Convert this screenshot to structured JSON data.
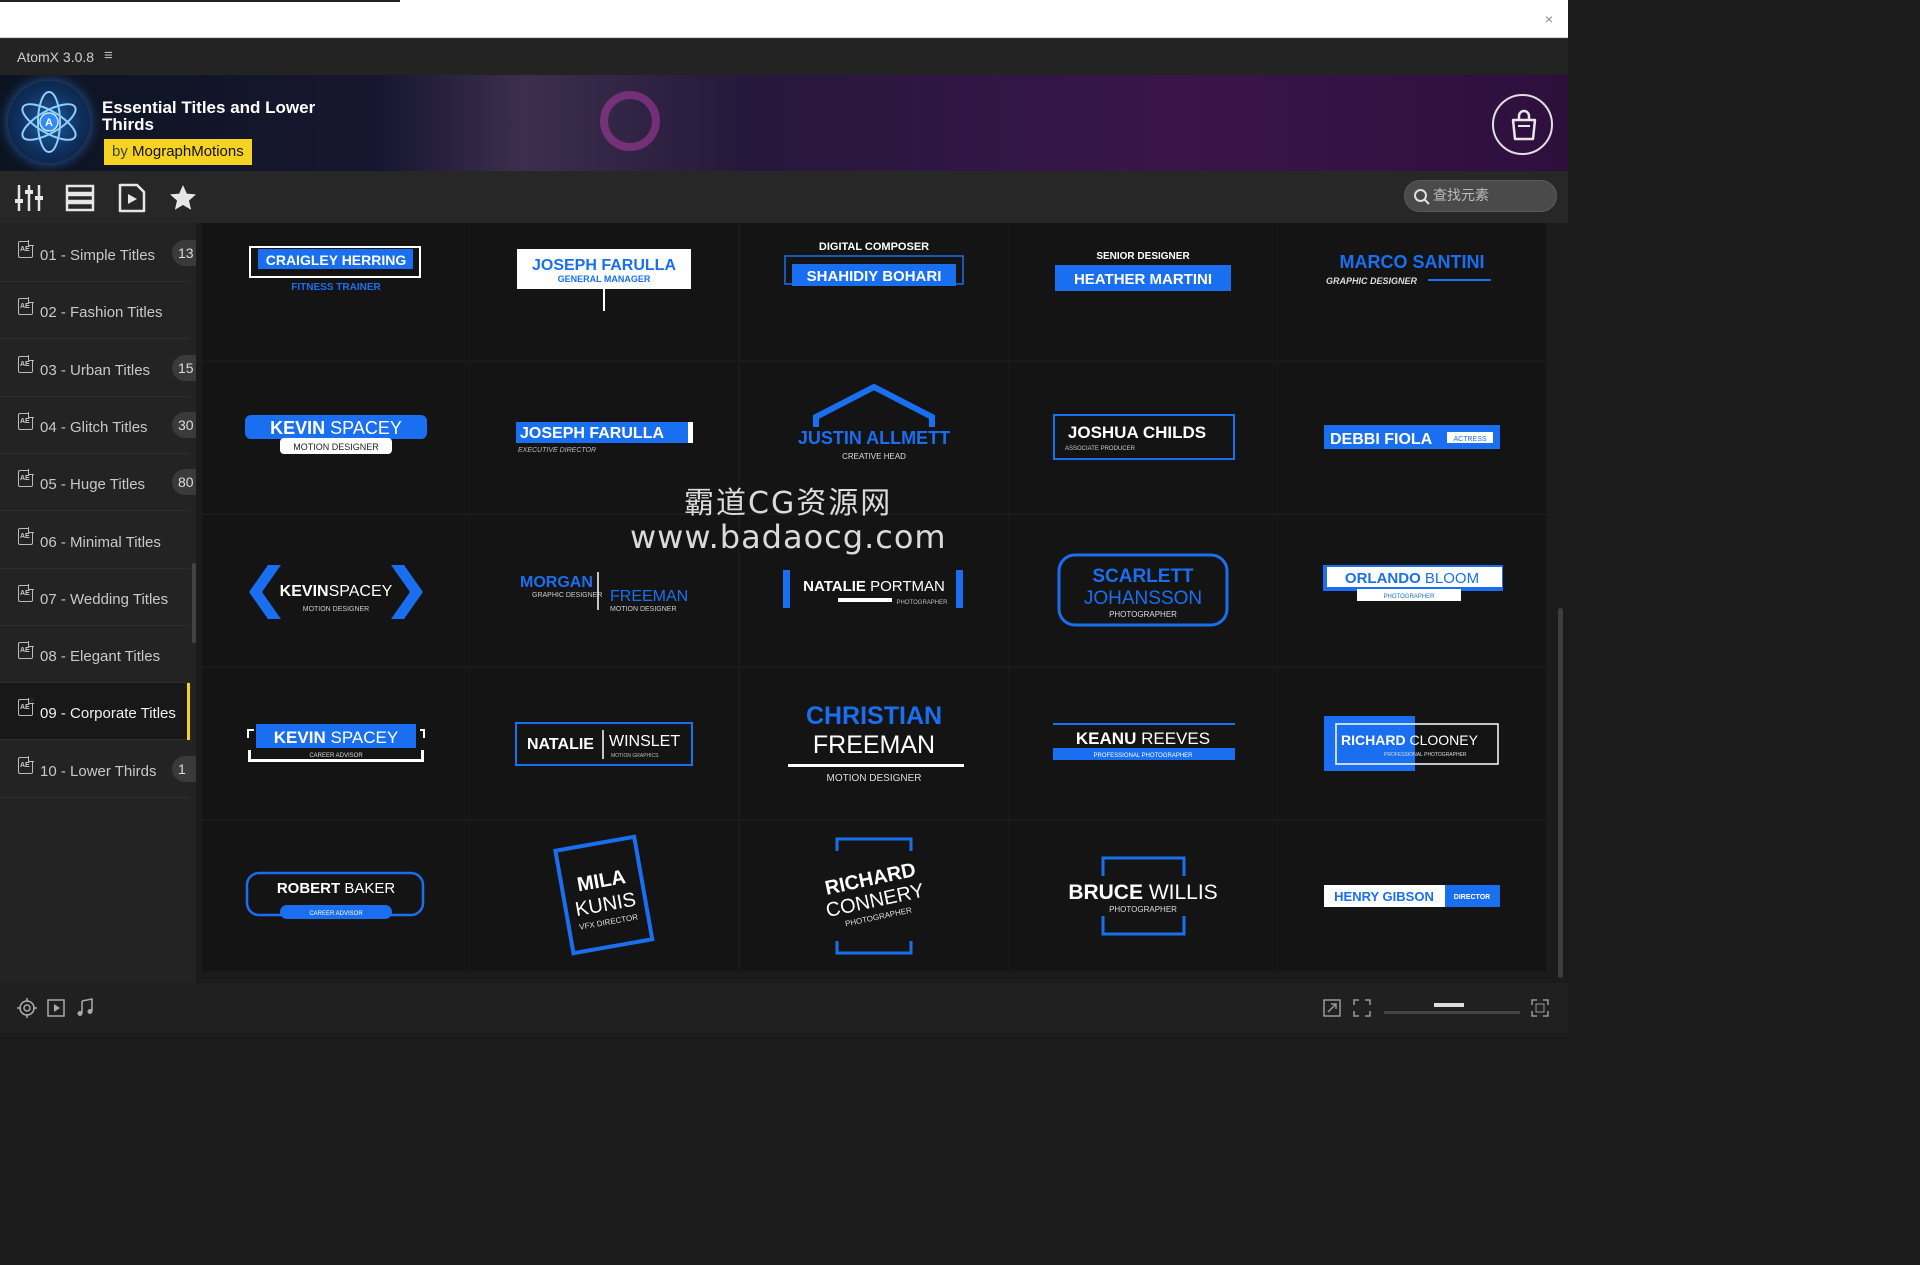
{
  "window": {
    "app_title": "AtomX 3.0.8",
    "menu_icon": "hamburger-menu-icon"
  },
  "banner": {
    "product_title": "Essential Titles and Lower Thirds",
    "author_prefix": "by",
    "author": "MographMotions",
    "cart_icon": "shopping-bag-icon"
  },
  "toolbar": {
    "icons": [
      "sliders-icon",
      "list-view-icon",
      "preview-icon",
      "star-icon"
    ],
    "search": {
      "placeholder": "查找元素",
      "value": ""
    }
  },
  "sidebar": {
    "items": [
      {
        "label": "01 - Simple Titles",
        "count": "13",
        "active": false
      },
      {
        "label": "02 - Fashion Titles",
        "count": "",
        "active": false
      },
      {
        "label": "03 - Urban Titles",
        "count": "15",
        "active": false
      },
      {
        "label": "04 - Glitch Titles",
        "count": "30",
        "active": false
      },
      {
        "label": "05 - Huge Titles",
        "count": "80",
        "active": false
      },
      {
        "label": "06 - Minimal Titles",
        "count": "",
        "active": false
      },
      {
        "label": "07 - Wedding Titles",
        "count": "",
        "active": false
      },
      {
        "label": "08 - Elegant Titles",
        "count": "",
        "active": false
      },
      {
        "label": "09 - Corporate Titles",
        "count": "",
        "active": true
      },
      {
        "label": "10 - Lower Thirds",
        "count": "1",
        "active": false
      }
    ]
  },
  "accent_color": "#1a6ff0",
  "tiles": [
    {
      "style": "t1",
      "name": "CRAIGLEY HERRING",
      "role": "FITNESS TRAINER"
    },
    {
      "style": "t2",
      "name": "JOSEPH FARULLA",
      "role": "GENERAL MANAGER"
    },
    {
      "style": "t3",
      "name": "SHAHIDIY BOHARI",
      "role": "DIGITAL COMPOSER"
    },
    {
      "style": "t4",
      "name": "HEATHER MARTINI",
      "role": "SENIOR DESIGNER"
    },
    {
      "style": "t5",
      "name": "MARCO SANTINI",
      "role": "GRAPHIC DESIGNER"
    },
    {
      "style": "t6",
      "first": "KEVIN",
      "last": "SPACEY",
      "role": "MOTION DESIGNER"
    },
    {
      "style": "t7",
      "name": "JOSEPH FARULLA",
      "role": "EXECUTIVE DIRECTOR"
    },
    {
      "style": "t8",
      "name": "JUSTIN ALLMETT",
      "role": "CREATIVE HEAD"
    },
    {
      "style": "t9",
      "name": "JOSHUA CHILDS",
      "role": "ASSOCIATE PRODUCER"
    },
    {
      "style": "t10",
      "name": "DEBBI FIOLA",
      "role": "ACTRESS"
    },
    {
      "style": "t11",
      "first": "KEVIN",
      "last": "SPACEY",
      "role": "MOTION DESIGNER"
    },
    {
      "style": "t12",
      "first": "MORGAN",
      "last": "FREEMAN",
      "role": "GRAPHIC DESIGNER",
      "role2": "MOTION DESIGNER"
    },
    {
      "style": "t13",
      "first": "NATALIE",
      "last": "PORTMAN",
      "role": "PHOTOGRAPHER"
    },
    {
      "style": "t14",
      "first": "SCARLETT",
      "last": "JOHANSSON",
      "role": "PHOTOGRAPHER"
    },
    {
      "style": "t15",
      "first": "ORLANDO",
      "last": "BLOOM",
      "role": "PHOTOGRAPHER"
    },
    {
      "style": "t16",
      "first": "KEVIN",
      "last": "SPACEY",
      "role": "CAREER ADVISOR"
    },
    {
      "style": "t17",
      "first": "NATALIE",
      "last": "WINSLET",
      "role": "MOTION GRAPHICS"
    },
    {
      "style": "t18",
      "first": "CHRISTIAN",
      "last": "FREEMAN",
      "role": "MOTION DESIGNER"
    },
    {
      "style": "t19",
      "first": "KEANU",
      "last": "REEVES",
      "role": "PROFESSIONAL PHOTOGRAPHER"
    },
    {
      "style": "t20",
      "first": "RICHARD",
      "last": "CLOONEY",
      "role": "PROFESSIONAL PHOTOGRAPHER"
    },
    {
      "style": "t21",
      "first": "ROBERT",
      "last": "BAKER",
      "role": "CAREER ADVISOR"
    },
    {
      "style": "t22",
      "first": "MILA",
      "last": "KUNIS",
      "role": "VFX DIRECTOR"
    },
    {
      "style": "t23",
      "first": "RICHARD",
      "last": "CONNERY",
      "role": "PHOTOGRAPHER"
    },
    {
      "style": "t24",
      "first": "BRUCE",
      "last": "WILLIS",
      "role": "PHOTOGRAPHER"
    },
    {
      "style": "t25",
      "name": "HENRY GIBSON",
      "role": "DIRECTOR"
    }
  ],
  "watermark": {
    "line1": "霸道CG资源网",
    "line2": "www.badaocg.com"
  },
  "bottombar": {
    "left_icons": [
      "target-icon",
      "play-box-icon",
      "music-note-icon"
    ],
    "right_icons": [
      "resize-icon",
      "fit-icon",
      "fullscreen-icon"
    ],
    "zoom": 0.55
  }
}
